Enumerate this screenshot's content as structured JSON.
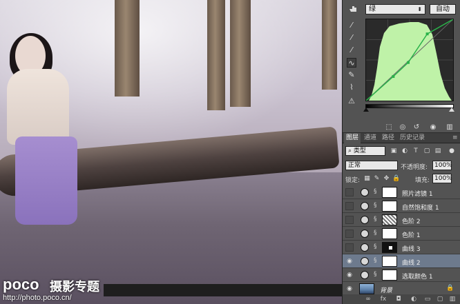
{
  "watermark": {
    "logo": "poco",
    "chinese": "摄影专题",
    "url": "http://photo.poco.cn/"
  },
  "properties": {
    "channel": "绿",
    "auto_label": "自动",
    "tools": [
      "hand-icon",
      "eyedropper-black-icon",
      "eyedropper-gray-icon",
      "eyedropper-white-icon",
      "curve-point-icon",
      "pencil-icon",
      "smooth-icon",
      "warning-icon"
    ],
    "curve": {
      "line_color": "#2ab24a",
      "histogram_color": "#bff2a8",
      "points": [
        [
          0,
          0
        ],
        [
          40,
          38
        ],
        [
          62,
          60
        ],
        [
          90,
          105
        ],
        [
          128,
          128
        ]
      ]
    }
  },
  "layers": {
    "tabs": [
      "图层",
      "通道",
      "路径",
      "历史记录"
    ],
    "active_tab": 0,
    "kind_filter": "类型",
    "blend_mode": "正常",
    "opacity_label": "不透明度:",
    "opacity_value": "100%",
    "lock_label": "锁定:",
    "fill_label": "填充:",
    "fill_value": "100%",
    "items": [
      {
        "name": "照片滤镜 1",
        "visible": false,
        "mask": "white",
        "selected": false
      },
      {
        "name": "自然饱和度 1",
        "visible": false,
        "mask": "white",
        "selected": false
      },
      {
        "name": "色阶 2",
        "visible": false,
        "mask": "noise",
        "selected": false
      },
      {
        "name": "色阶 1",
        "visible": false,
        "mask": "white",
        "selected": false
      },
      {
        "name": "曲线 3",
        "visible": false,
        "mask": "dark",
        "selected": false
      },
      {
        "name": "曲线 2",
        "visible": true,
        "mask": "white",
        "selected": true
      },
      {
        "name": "选取颜色 1",
        "visible": true,
        "mask": "white",
        "selected": false
      }
    ],
    "background": {
      "name": "背景",
      "visible": true
    }
  }
}
